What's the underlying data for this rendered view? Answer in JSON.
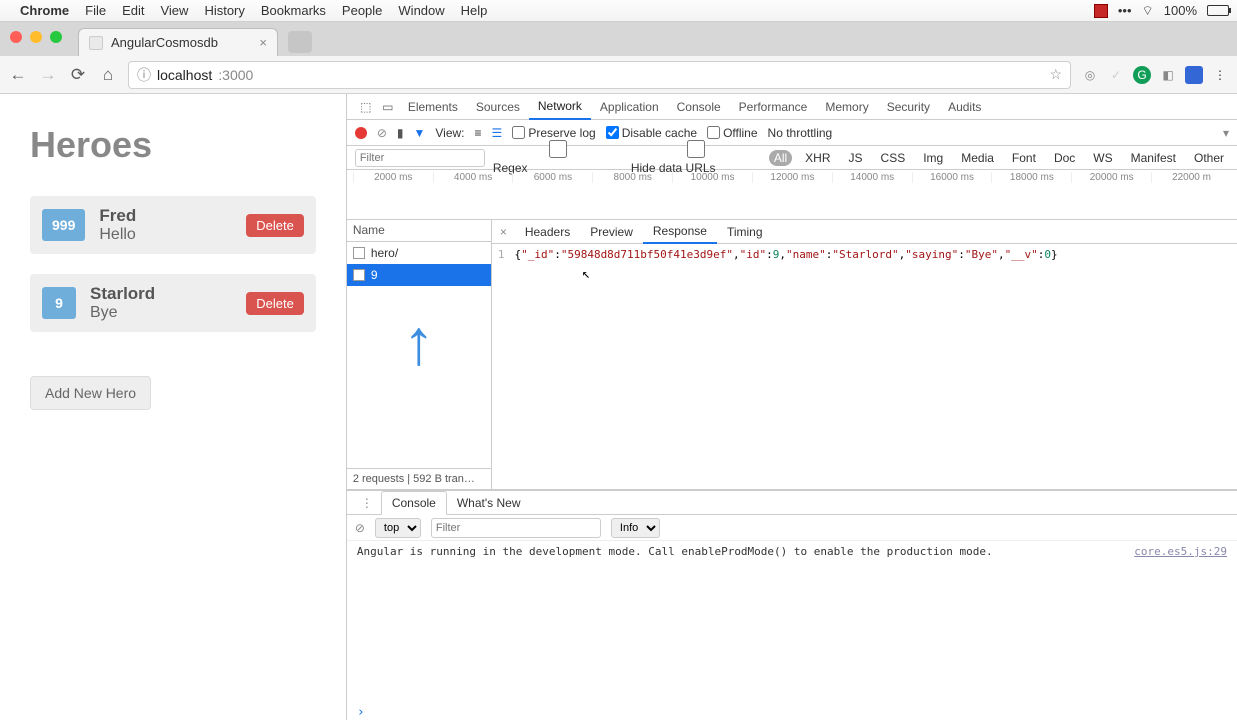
{
  "menubar": {
    "app": "Chrome",
    "items": [
      "File",
      "Edit",
      "View",
      "History",
      "Bookmarks",
      "People",
      "Window",
      "Help"
    ],
    "battery": "100%"
  },
  "tab": {
    "title": "AngularCosmosdb"
  },
  "url": {
    "host": "localhost",
    "port": ":3000"
  },
  "page": {
    "title": "Heroes",
    "heroes": [
      {
        "id": "999",
        "name": "Fred",
        "saying": "Hello"
      },
      {
        "id": "9",
        "name": "Starlord",
        "saying": "Bye"
      }
    ],
    "delete_label": "Delete",
    "add_label": "Add New Hero"
  },
  "devtools": {
    "tabs": [
      "Elements",
      "Sources",
      "Network",
      "Application",
      "Console",
      "Performance",
      "Memory",
      "Security",
      "Audits"
    ],
    "active_tab": "Network",
    "nettool": {
      "view_label": "View:",
      "preserve_log": "Preserve log",
      "disable_cache": "Disable cache",
      "disable_cache_checked": true,
      "offline": "Offline",
      "throttling": "No throttling"
    },
    "filter": {
      "placeholder": "Filter",
      "regex": "Regex",
      "hide_data": "Hide data URLs",
      "types": [
        "All",
        "XHR",
        "JS",
        "CSS",
        "Img",
        "Media",
        "Font",
        "Doc",
        "WS",
        "Manifest",
        "Other"
      ],
      "active_type": "All"
    },
    "timeline_ticks": [
      "2000 ms",
      "4000 ms",
      "6000 ms",
      "8000 ms",
      "10000 ms",
      "12000 ms",
      "14000 ms",
      "16000 ms",
      "18000 ms",
      "20000 ms",
      "22000 m"
    ],
    "reqlist": {
      "header": "Name",
      "rows": [
        "hero/",
        "9"
      ],
      "selected": 1,
      "footer": "2 requests | 592 B tran…"
    },
    "detail": {
      "tabs": [
        "Headers",
        "Preview",
        "Response",
        "Timing"
      ],
      "active": "Response",
      "response_line": "1",
      "response_json": {
        "_id": "59848d8d711bf50f41e3d9ef",
        "id": 9,
        "name": "Starlord",
        "saying": "Bye",
        "__v": 0
      }
    },
    "drawer": {
      "tabs": [
        "Console",
        "What's New"
      ],
      "active": "Console",
      "context": "top",
      "filter_placeholder": "Filter",
      "level": "Info",
      "log_message": "Angular is running in the development mode. Call enableProdMode() to enable the production mode.",
      "log_source": "core.es5.js:29"
    }
  }
}
